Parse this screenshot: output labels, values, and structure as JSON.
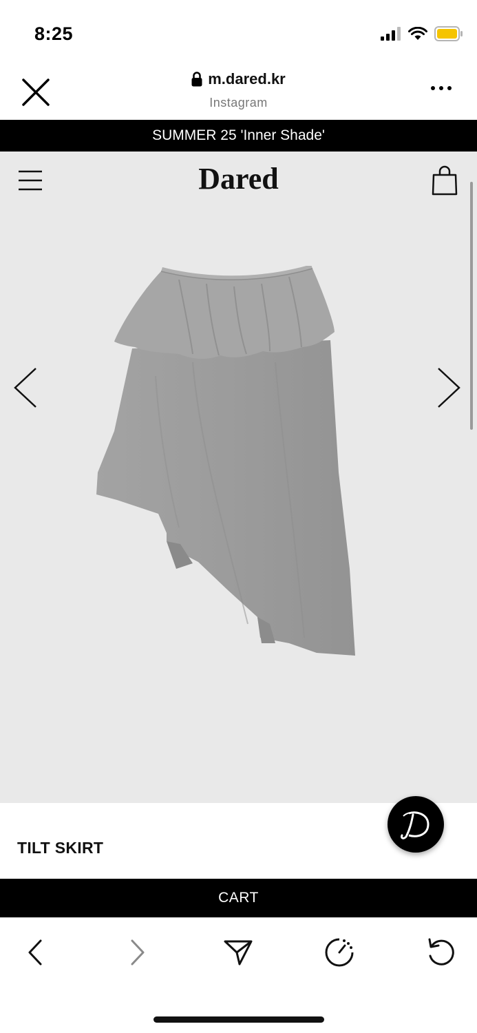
{
  "status_bar": {
    "time": "8:25",
    "icons": [
      "signal-icon",
      "wifi-icon",
      "battery-icon"
    ],
    "battery_color": "#f5c400"
  },
  "browser": {
    "url": "m.dared.kr",
    "subtitle": "Instagram",
    "icons": [
      "close-icon",
      "lock-icon",
      "more-icon"
    ]
  },
  "announcement": "SUMMER 25 'Inner Shade'",
  "site": {
    "logo": "Dared",
    "icons": [
      "menu-icon",
      "shopping-bag-icon",
      "chevron-left-icon",
      "chevron-right-icon"
    ]
  },
  "product": {
    "name": "TILT SKIRT",
    "image": "grey-asymmetric-ruffle-skirt",
    "image_color": "#9e9e9e"
  },
  "chat_fab": {
    "icon": "dared-d-logo-icon"
  },
  "cart_label": "CART",
  "toolbar": {
    "buttons": [
      "back-icon",
      "forward-icon",
      "share-icon",
      "speed-icon",
      "reload-icon"
    ]
  },
  "colors": {
    "accent": "#000000",
    "viewport_bg": "#e9e9e9"
  }
}
